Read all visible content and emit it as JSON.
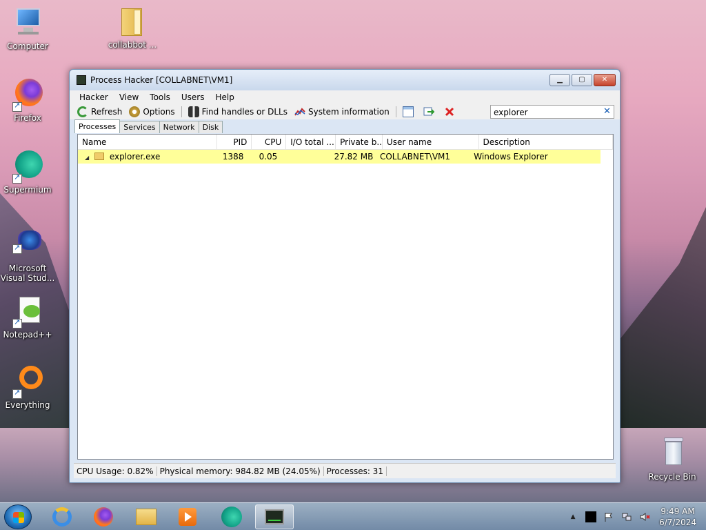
{
  "desktop": {
    "icons": [
      {
        "label": "Computer"
      },
      {
        "label": "collabbot ..."
      },
      {
        "label": "Firefox"
      },
      {
        "label": "Supermium"
      },
      {
        "label": "Microsoft Visual Stud..."
      },
      {
        "label": "Notepad++"
      },
      {
        "label": "Everything"
      },
      {
        "label": "Recycle Bin"
      }
    ]
  },
  "window": {
    "title": "Process Hacker [COLLABNET\\VM1]",
    "buttons": {
      "minimize": "▁",
      "maximize": "▢",
      "close": "✕"
    },
    "menu": [
      "Hacker",
      "View",
      "Tools",
      "Users",
      "Help"
    ],
    "toolbar": {
      "refresh": "Refresh",
      "options": "Options",
      "find": "Find handles or DLLs",
      "sysinfo": "System information",
      "search_value": "explorer",
      "search_clear": "✕"
    },
    "tabs": [
      "Processes",
      "Services",
      "Network",
      "Disk"
    ],
    "columns": [
      "Name",
      "PID",
      "CPU",
      "I/O total ...",
      "Private b...",
      "User name",
      "Description"
    ],
    "rows": [
      {
        "expander": "◢",
        "name": "explorer.exe",
        "pid": "1388",
        "cpu": "0.05",
        "io": "",
        "private": "27.82 MB",
        "user": "COLLABNET\\VM1",
        "description": "Windows Explorer"
      }
    ],
    "status": {
      "cpu": "CPU Usage: 0.82%",
      "memory": "Physical memory: 984.82 MB (24.05%)",
      "processes": "Processes: 31"
    }
  },
  "taskbar": {
    "clock_time": "9:49 AM",
    "clock_date": "6/7/2024",
    "tray_up": "▲"
  },
  "colors": {
    "highlight_row": "#ffff99",
    "accent": "#1a5fb4"
  }
}
